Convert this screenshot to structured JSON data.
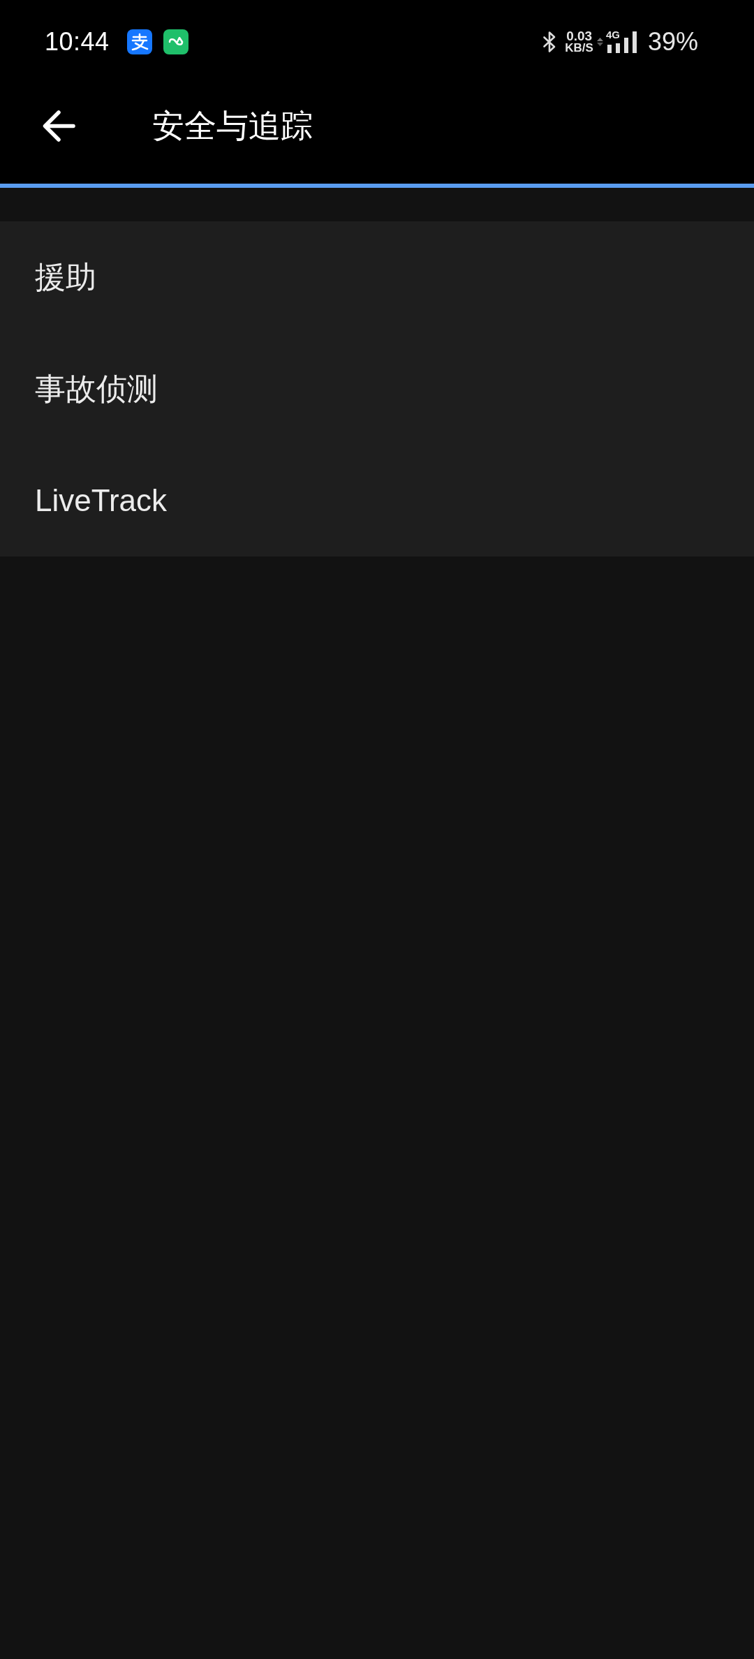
{
  "status_bar": {
    "time": "10:44",
    "net_speed": "0.03",
    "net_speed_unit": "KB/S",
    "network_type": "4G",
    "battery": "39%"
  },
  "header": {
    "title": "安全与追踪"
  },
  "menu": {
    "items": [
      {
        "label": "援助"
      },
      {
        "label": "事故侦测"
      },
      {
        "label": "LiveTrack"
      }
    ]
  }
}
